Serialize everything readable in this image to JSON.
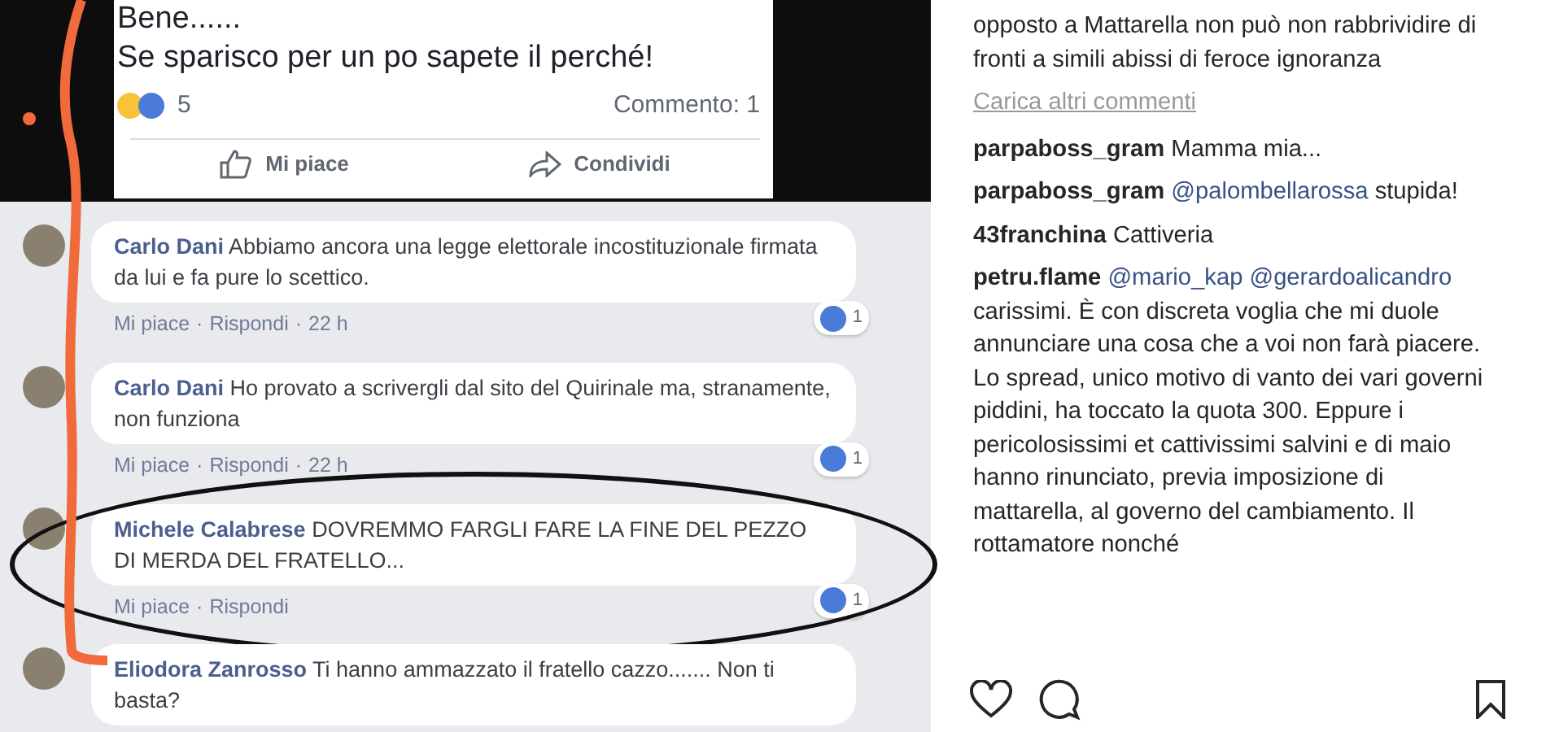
{
  "post": {
    "lines": [
      "Bene......",
      "Se sparisco per un po sapete il perché!"
    ],
    "reaction_count": "5",
    "comment_count": "Commento: 1",
    "actions": [
      "Mi piace",
      "Condividi"
    ]
  },
  "comments": [
    {
      "author": "Carlo Dani",
      "text": "Abbiamo ancora una legge elettorale incostituzionale firmata da lui e fa pure lo scettico.",
      "actions": [
        "Mi piace",
        "Rispondi"
      ],
      "separator": "·",
      "time": "22 h",
      "likes": "1",
      "circled": false
    },
    {
      "author": "Carlo Dani",
      "text": "Ho provato a scrivergli dal sito del Quirinale ma, stranamente, non funziona",
      "actions": [
        "Mi piace",
        "Rispondi"
      ],
      "separator": "·",
      "time": "22 h",
      "likes": "1",
      "circled": false
    },
    {
      "author": "Michele Calabrese",
      "text": "DOVREMMO FARGLI FARE LA FINE DEL PEZZO DI MERDA DEL FRATELLO...",
      "actions": [
        "Mi piace",
        "Rispondi"
      ],
      "separator": "·",
      "likes": "1",
      "circled": true
    },
    {
      "author": "Eliodora Zanrosso",
      "text": "Ti hanno ammazzato il fratello cazzo....... Non ti basta?",
      "circled": false
    }
  ],
  "instagram": {
    "items": [
      {
        "kind": "text",
        "text": "opposto a Mattarella non può non rabbrividire di fronti a simili abissi di feroce ignoranza"
      },
      {
        "kind": "more",
        "text": "Carica altri commenti"
      },
      {
        "kind": "comment",
        "author": "parpaboss_gram",
        "text": "Mamma mia..."
      },
      {
        "kind": "comment",
        "author": "parpaboss_gram",
        "mentions": [
          "@palombellarossa"
        ],
        "text": "stupida!"
      },
      {
        "kind": "comment",
        "author": "43franchina",
        "text": "Cattiveria"
      },
      {
        "kind": "comment",
        "author": "petru.flame",
        "mentions": [
          "@mario_kap",
          "@gerardoalicandro"
        ],
        "text": "carissimi. È con discreta voglia che mi duole annunciare una cosa che a voi non farà piacere. Lo spread, unico motivo di vanto dei vari governi piddini, ha toccato la quota 300. Eppure i pericolosissimi et cattivissimi salvini e di maio hanno rinunciato, previa imposizione di mattarella, al governo del cambiamento. Il rottamatore nonché"
      }
    ]
  }
}
